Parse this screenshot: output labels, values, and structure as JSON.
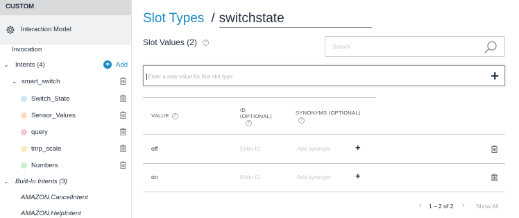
{
  "sidebar": {
    "section_label": "CUSTOM",
    "interaction_model": "Interaction Model",
    "invocation": "Invocation",
    "intents_label": "Intents (4)",
    "add_label": "Add",
    "smart_switch": "smart_switch",
    "slots": [
      {
        "label": "Switch_State",
        "color": "#cde6f7"
      },
      {
        "label": "Sensor_Values",
        "color": "#fbdcc2"
      },
      {
        "label": "query",
        "color": "#f7c9cf"
      },
      {
        "label": "tmp_scale",
        "color": "#fde8c0"
      },
      {
        "label": "Numbers",
        "color": "#cdeed1"
      }
    ],
    "builtin_label": "Built-In Intents (3)",
    "builtin_items": [
      "AMAZON.CancelIntent",
      "AMAZON.HelpIntent"
    ]
  },
  "main": {
    "breadcrumb_link": "Slot Types",
    "breadcrumb_sep": "/",
    "slot_type_name": "switchstate",
    "slot_values_label": "Slot Values (2)",
    "search_placeholder": "Search",
    "new_value_placeholder": "Enter a new value for this slot type",
    "columns": {
      "value": "VALUE",
      "id_line1": "ID",
      "id_line2": "(OPTIONAL)",
      "synonyms": "SYNONYMS (OPTIONAL)"
    },
    "rows": [
      {
        "value": "off",
        "id_placeholder": "Enter ID",
        "synonym_placeholder": "Add synonym"
      },
      {
        "value": "on",
        "id_placeholder": "Enter ID",
        "synonym_placeholder": "Add synonym"
      }
    ],
    "pager": {
      "text": "1 – 2 of 2",
      "show_all": "Show All"
    }
  },
  "colors": {
    "accent": "#1a8ac6",
    "sidebar_header": "#d9dadc"
  }
}
